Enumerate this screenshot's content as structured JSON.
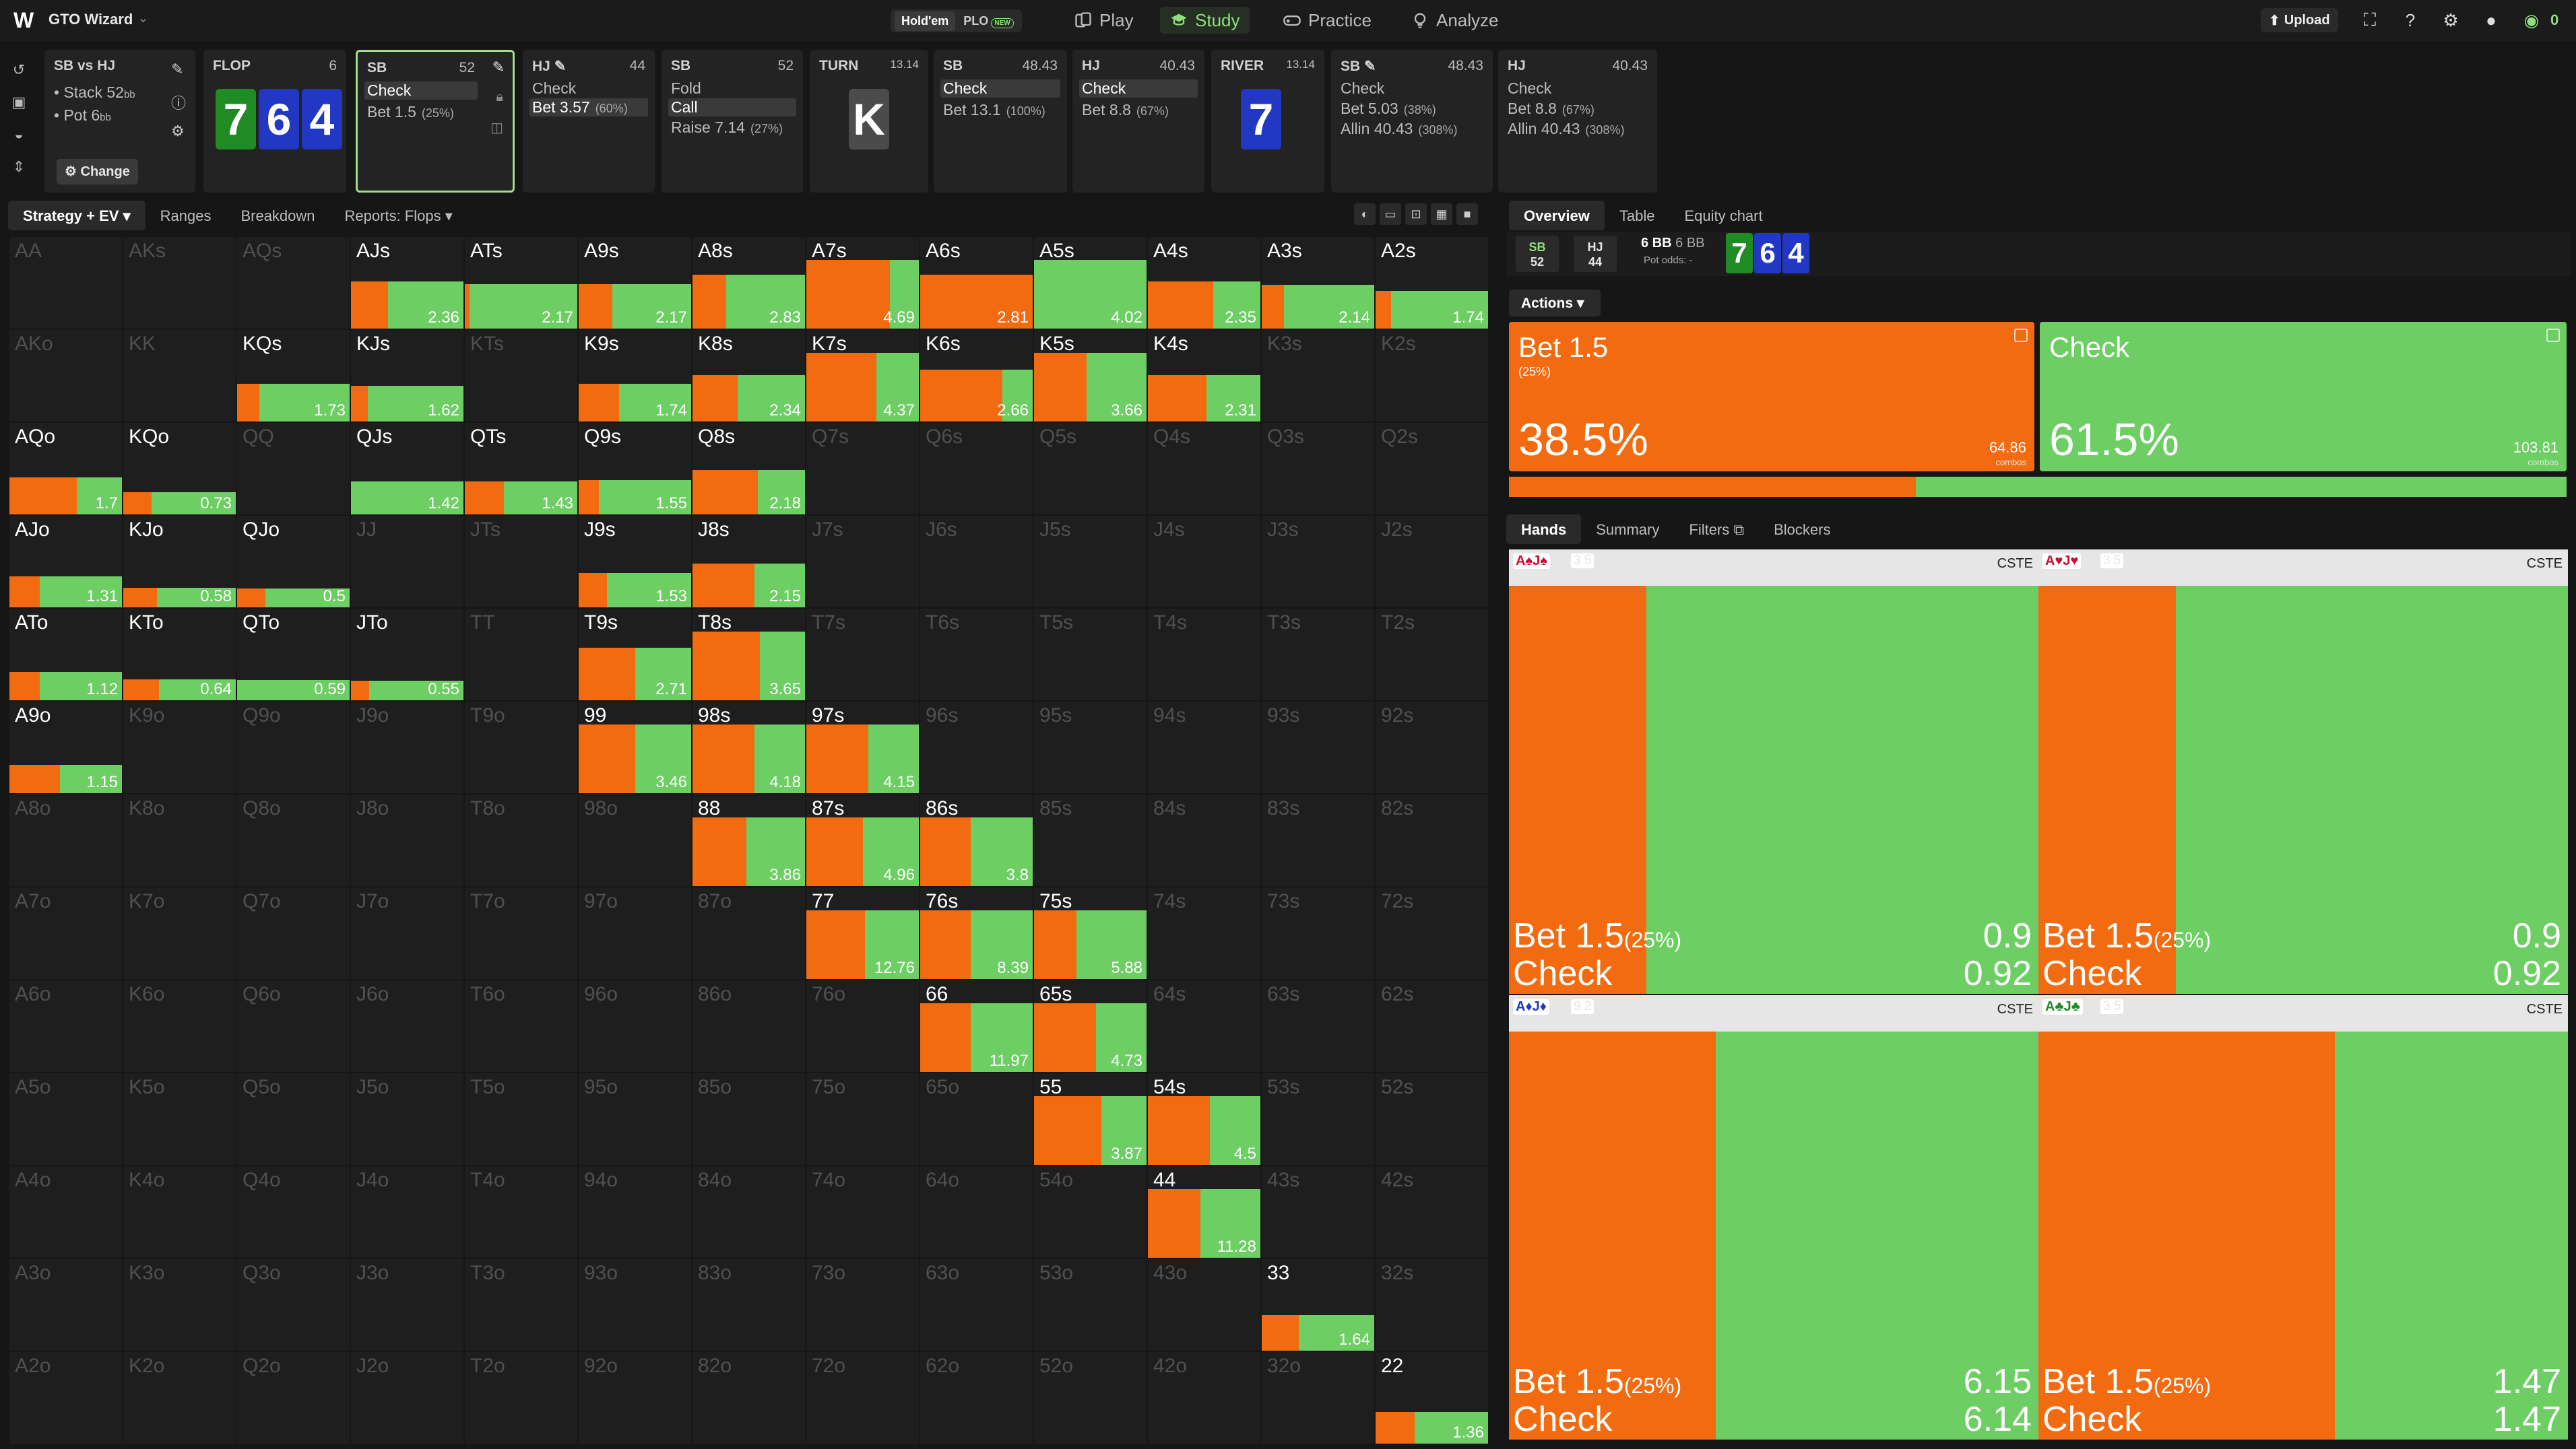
{
  "app": {
    "name": "GTO Wizard",
    "variant_on": "Hold'em",
    "variant_off": "PLO",
    "variant_new": "NEW"
  },
  "nav": {
    "play": "Play",
    "study": "Study",
    "practice": "Practice",
    "analyze": "Analyze",
    "upload": "Upload",
    "coins": "0"
  },
  "colors": {
    "bet": "#f26b10",
    "check": "#6cce63",
    "active_border": "#9fe08a",
    "board_green": "#1e8b23",
    "board_blue": "#2238c2"
  },
  "spot": {
    "title": "SB vs HJ",
    "stack": "Stack 52",
    "stack_unit": "bb",
    "pot": "Pot 6",
    "pot_unit": "bb",
    "change": "Change"
  },
  "flop": {
    "label": "FLOP",
    "num": "6",
    "cards": [
      "7",
      "6",
      "4"
    ]
  },
  "p_sb1": {
    "pos": "SB",
    "stack": "52",
    "a1": "Check",
    "a2": "Bet 1.5",
    "a2p": "(25%)"
  },
  "p_hj1": {
    "pos": "HJ",
    "stack": "44",
    "a1": "Check",
    "a2": "Bet 3.57",
    "a2p": "(60%)"
  },
  "p_sb2": {
    "pos": "SB",
    "stack": "52",
    "a1": "Fold",
    "a2": "Call",
    "a3": "Raise 7.14",
    "a3p": "(27%)"
  },
  "turn": {
    "label": "TURN",
    "num": "13.14",
    "card": "K"
  },
  "p_sb3": {
    "pos": "SB",
    "stack": "48.43",
    "a1": "Check",
    "a2": "Bet 13.1",
    "a2p": "(100%)"
  },
  "p_hj2": {
    "pos": "HJ",
    "stack": "40.43",
    "a1": "Check",
    "a2": "Bet 8.8",
    "a2p": "(67%)"
  },
  "river": {
    "label": "RIVER",
    "num": "13.14",
    "card": "7"
  },
  "p_sb4": {
    "pos": "SB",
    "stack": "48.43",
    "a1": "Check",
    "a2": "Bet 5.03",
    "a2p": "(38%)",
    "a3": "Allin 40.43",
    "a3p": "(308%)"
  },
  "p_hj3": {
    "pos": "HJ",
    "stack": "40.43",
    "a1": "Check",
    "a2": "Bet 8.8",
    "a2p": "(67%)",
    "a3": "Allin 40.43",
    "a3p": "(308%)"
  },
  "grid_tabs": [
    "Strategy + EV",
    "Ranges",
    "Breakdown",
    "Reports: Flops"
  ],
  "right_tabs": [
    "Overview",
    "Table",
    "Equity chart"
  ],
  "pot_panel": {
    "sb": "SB",
    "sb_stack": "52",
    "hj": "HJ",
    "hj_stack": "44",
    "bb1": "6 BB",
    "bb2": "6 BB",
    "odds": "Pot odds:  -",
    "cards": [
      "7",
      "6",
      "4"
    ]
  },
  "actions_label": "Actions",
  "bet_box": {
    "title": "Bet 1.5",
    "size": "(25%)",
    "pct": "38.5%",
    "combos": "64.86",
    "combos_label": "combos",
    "freq": 0.385
  },
  "check_box": {
    "title": "Check",
    "pct": "61.5%",
    "combos": "103.81",
    "combos_label": "combos",
    "freq": 0.615
  },
  "hand_tabs": [
    "Hands",
    "Summary",
    "Filters",
    "Blockers"
  ],
  "combos": [
    {
      "cards": "A♠J♠",
      "c1": "red",
      "blk": "3 5",
      "cste": "CSTE",
      "a1": "Bet 1.5",
      "a1p": "(25%)",
      "a2": "Check",
      "v1": "0.9",
      "v2": "0.92",
      "bet_freq": 0.26
    },
    {
      "cards": "A♥J♥",
      "c1": "red",
      "blk": "3 5",
      "cste": "CSTE",
      "a1": "Bet 1.5",
      "a1p": "(25%)",
      "a2": "Check",
      "v1": "0.9",
      "v2": "0.92",
      "bet_freq": 0.26
    },
    {
      "cards": "A♦J♦",
      "c1": "blu",
      "blk": "9 2",
      "cste": "CSTE",
      "a1": "Bet 1.5",
      "a1p": "(25%)",
      "a2": "Check",
      "v1": "6.15",
      "v2": "6.14",
      "bet_freq": 0.39
    },
    {
      "cards": "A♣J♣",
      "c1": "grn",
      "blk": "3 5",
      "cste": "CSTE",
      "a1": "Bet 1.5",
      "a1p": "(25%)",
      "a2": "Check",
      "v1": "1.47",
      "v2": "1.47",
      "bet_freq": 0.56
    }
  ],
  "grid": [
    [
      [
        "AA",
        0,
        0,
        ""
      ],
      [
        "AKs",
        0,
        0,
        ""
      ],
      [
        "AQs",
        0,
        0,
        ""
      ],
      [
        "AJs",
        1,
        0.33,
        "2.36"
      ],
      [
        "ATs",
        1,
        0.04,
        "2.17"
      ],
      [
        "A9s",
        1,
        0.3,
        "2.17"
      ],
      [
        "A8s",
        1,
        0.3,
        "2.83"
      ],
      [
        "A7s",
        1,
        0.74,
        "4.69"
      ],
      [
        "A6s",
        1,
        1,
        "2.81"
      ],
      [
        "A5s",
        1,
        0,
        "4.02"
      ],
      [
        "A4s",
        1,
        0.58,
        "2.35"
      ],
      [
        "A3s",
        1,
        0.2,
        "2.14"
      ],
      [
        "A2s",
        1,
        0.14,
        "1.74"
      ]
    ],
    [
      [
        "AKo",
        0,
        0,
        ""
      ],
      [
        "KK",
        0,
        0,
        ""
      ],
      [
        "KQs",
        1,
        0.2,
        "1.73"
      ],
      [
        "KJs",
        1,
        0.15,
        "1.62"
      ],
      [
        "KTs",
        0,
        0,
        ""
      ],
      [
        "K9s",
        1,
        0.36,
        "1.74"
      ],
      [
        "K8s",
        1,
        0.4,
        "2.34"
      ],
      [
        "K7s",
        1,
        0.62,
        "4.37"
      ],
      [
        "K6s",
        1,
        0.73,
        "2.66"
      ],
      [
        "K5s",
        1,
        0.47,
        "3.66"
      ],
      [
        "K4s",
        1,
        0.52,
        "2.31"
      ],
      [
        "K3s",
        0,
        0,
        ""
      ],
      [
        "K2s",
        0,
        0,
        ""
      ]
    ],
    [
      [
        "AQo",
        1,
        0.6,
        "1.7"
      ],
      [
        "KQo",
        1,
        0.25,
        "0.73"
      ],
      [
        "QQ",
        0,
        0,
        ""
      ],
      [
        "QJs",
        1,
        0,
        "1.42"
      ],
      [
        "QTs",
        1,
        0.35,
        "1.43"
      ],
      [
        "Q9s",
        1,
        0.18,
        "1.55"
      ],
      [
        "Q8s",
        1,
        0.58,
        "2.18"
      ],
      [
        "Q7s",
        0,
        0,
        ""
      ],
      [
        "Q6s",
        0,
        0,
        ""
      ],
      [
        "Q5s",
        0,
        0,
        ""
      ],
      [
        "Q4s",
        0,
        0,
        ""
      ],
      [
        "Q3s",
        0,
        0,
        ""
      ],
      [
        "Q2s",
        0,
        0,
        ""
      ]
    ],
    [
      [
        "AJo",
        1,
        0.27,
        "1.31"
      ],
      [
        "KJo",
        1,
        0.3,
        "0.58"
      ],
      [
        "QJo",
        1,
        0.25,
        "0.5"
      ],
      [
        "JJ",
        0,
        0,
        ""
      ],
      [
        "JTs",
        0,
        0,
        ""
      ],
      [
        "J9s",
        1,
        0.25,
        "1.53"
      ],
      [
        "J8s",
        1,
        0.55,
        "2.15"
      ],
      [
        "J7s",
        0,
        0,
        ""
      ],
      [
        "J6s",
        0,
        0,
        ""
      ],
      [
        "J5s",
        0,
        0,
        ""
      ],
      [
        "J4s",
        0,
        0,
        ""
      ],
      [
        "J3s",
        0,
        0,
        ""
      ],
      [
        "J2s",
        0,
        0,
        ""
      ]
    ],
    [
      [
        "ATo",
        1,
        0.27,
        "1.12"
      ],
      [
        "KTo",
        1,
        0.32,
        "0.64"
      ],
      [
        "QTo",
        1,
        0,
        "0.59"
      ],
      [
        "JTo",
        1,
        0.16,
        "0.55"
      ],
      [
        "TT",
        0,
        0,
        ""
      ],
      [
        "T9s",
        1,
        0.5,
        "2.71"
      ],
      [
        "T8s",
        1,
        0.6,
        "3.65"
      ],
      [
        "T7s",
        0,
        0,
        ""
      ],
      [
        "T6s",
        0,
        0,
        ""
      ],
      [
        "T5s",
        0,
        0,
        ""
      ],
      [
        "T4s",
        0,
        0,
        ""
      ],
      [
        "T3s",
        0,
        0,
        ""
      ],
      [
        "T2s",
        0,
        0,
        ""
      ]
    ],
    [
      [
        "A9o",
        1,
        0.45,
        "1.15"
      ],
      [
        "K9o",
        0,
        0,
        ""
      ],
      [
        "Q9o",
        0,
        0,
        ""
      ],
      [
        "J9o",
        0,
        0,
        ""
      ],
      [
        "T9o",
        0,
        0,
        ""
      ],
      [
        "99",
        1,
        0.5,
        "3.46"
      ],
      [
        "98s",
        1,
        0.55,
        "4.18"
      ],
      [
        "97s",
        1,
        0.55,
        "4.15"
      ],
      [
        "96s",
        0,
        0,
        ""
      ],
      [
        "95s",
        0,
        0,
        ""
      ],
      [
        "94s",
        0,
        0,
        ""
      ],
      [
        "93s",
        0,
        0,
        ""
      ],
      [
        "92s",
        0,
        0,
        ""
      ]
    ],
    [
      [
        "A8o",
        0,
        0,
        ""
      ],
      [
        "K8o",
        0,
        0,
        ""
      ],
      [
        "Q8o",
        0,
        0,
        ""
      ],
      [
        "J8o",
        0,
        0,
        ""
      ],
      [
        "T8o",
        0,
        0,
        ""
      ],
      [
        "98o",
        0,
        0,
        ""
      ],
      [
        "88",
        1,
        0.48,
        "3.86"
      ],
      [
        "87s",
        1,
        0.5,
        "4.96"
      ],
      [
        "86s",
        1,
        0.45,
        "3.8"
      ],
      [
        "85s",
        0,
        0,
        ""
      ],
      [
        "84s",
        0,
        0,
        ""
      ],
      [
        "83s",
        0,
        0,
        ""
      ],
      [
        "82s",
        0,
        0,
        ""
      ]
    ],
    [
      [
        "A7o",
        0,
        0,
        ""
      ],
      [
        "K7o",
        0,
        0,
        ""
      ],
      [
        "Q7o",
        0,
        0,
        ""
      ],
      [
        "J7o",
        0,
        0,
        ""
      ],
      [
        "T7o",
        0,
        0,
        ""
      ],
      [
        "97o",
        0,
        0,
        ""
      ],
      [
        "87o",
        0,
        0,
        ""
      ],
      [
        "77",
        1,
        0.52,
        "12.76"
      ],
      [
        "76s",
        1,
        0.45,
        "8.39"
      ],
      [
        "75s",
        1,
        0.38,
        "5.88"
      ],
      [
        "74s",
        0,
        0,
        ""
      ],
      [
        "73s",
        0,
        0,
        ""
      ],
      [
        "72s",
        0,
        0,
        ""
      ]
    ],
    [
      [
        "A6o",
        0,
        0,
        ""
      ],
      [
        "K6o",
        0,
        0,
        ""
      ],
      [
        "Q6o",
        0,
        0,
        ""
      ],
      [
        "J6o",
        0,
        0,
        ""
      ],
      [
        "T6o",
        0,
        0,
        ""
      ],
      [
        "96o",
        0,
        0,
        ""
      ],
      [
        "86o",
        0,
        0,
        ""
      ],
      [
        "76o",
        0,
        0,
        ""
      ],
      [
        "66",
        1,
        0.45,
        "11.97"
      ],
      [
        "65s",
        1,
        0.55,
        "4.73"
      ],
      [
        "64s",
        0,
        0,
        ""
      ],
      [
        "63s",
        0,
        0,
        ""
      ],
      [
        "62s",
        0,
        0,
        ""
      ]
    ],
    [
      [
        "A5o",
        0,
        0,
        ""
      ],
      [
        "K5o",
        0,
        0,
        ""
      ],
      [
        "Q5o",
        0,
        0,
        ""
      ],
      [
        "J5o",
        0,
        0,
        ""
      ],
      [
        "T5o",
        0,
        0,
        ""
      ],
      [
        "95o",
        0,
        0,
        ""
      ],
      [
        "85o",
        0,
        0,
        ""
      ],
      [
        "75o",
        0,
        0,
        ""
      ],
      [
        "65o",
        0,
        0,
        ""
      ],
      [
        "55",
        1,
        0.6,
        "3.87"
      ],
      [
        "54s",
        1,
        0.55,
        "4.5"
      ],
      [
        "53s",
        0,
        0,
        ""
      ],
      [
        "52s",
        0,
        0,
        ""
      ]
    ],
    [
      [
        "A4o",
        0,
        0,
        ""
      ],
      [
        "K4o",
        0,
        0,
        ""
      ],
      [
        "Q4o",
        0,
        0,
        ""
      ],
      [
        "J4o",
        0,
        0,
        ""
      ],
      [
        "T4o",
        0,
        0,
        ""
      ],
      [
        "94o",
        0,
        0,
        ""
      ],
      [
        "84o",
        0,
        0,
        ""
      ],
      [
        "74o",
        0,
        0,
        ""
      ],
      [
        "64o",
        0,
        0,
        ""
      ],
      [
        "54o",
        0,
        0,
        ""
      ],
      [
        "44",
        1,
        0.47,
        "11.28"
      ],
      [
        "43s",
        0,
        0,
        ""
      ],
      [
        "42s",
        0,
        0,
        ""
      ]
    ],
    [
      [
        "A3o",
        0,
        0,
        ""
      ],
      [
        "K3o",
        0,
        0,
        ""
      ],
      [
        "Q3o",
        0,
        0,
        ""
      ],
      [
        "J3o",
        0,
        0,
        ""
      ],
      [
        "T3o",
        0,
        0,
        ""
      ],
      [
        "93o",
        0,
        0,
        ""
      ],
      [
        "83o",
        0,
        0,
        ""
      ],
      [
        "73o",
        0,
        0,
        ""
      ],
      [
        "63o",
        0,
        0,
        ""
      ],
      [
        "53o",
        0,
        0,
        ""
      ],
      [
        "43o",
        0,
        0,
        ""
      ],
      [
        "33",
        1,
        0.33,
        "1.64"
      ],
      [
        "32s",
        0,
        0,
        ""
      ]
    ],
    [
      [
        "A2o",
        0,
        0,
        ""
      ],
      [
        "K2o",
        0,
        0,
        ""
      ],
      [
        "Q2o",
        0,
        0,
        ""
      ],
      [
        "J2o",
        0,
        0,
        ""
      ],
      [
        "T2o",
        0,
        0,
        ""
      ],
      [
        "92o",
        0,
        0,
        ""
      ],
      [
        "82o",
        0,
        0,
        ""
      ],
      [
        "72o",
        0,
        0,
        ""
      ],
      [
        "62o",
        0,
        0,
        ""
      ],
      [
        "52o",
        0,
        0,
        ""
      ],
      [
        "42o",
        0,
        0,
        ""
      ],
      [
        "32o",
        0,
        0,
        ""
      ],
      [
        "22",
        1,
        0.35,
        "1.36"
      ]
    ]
  ]
}
